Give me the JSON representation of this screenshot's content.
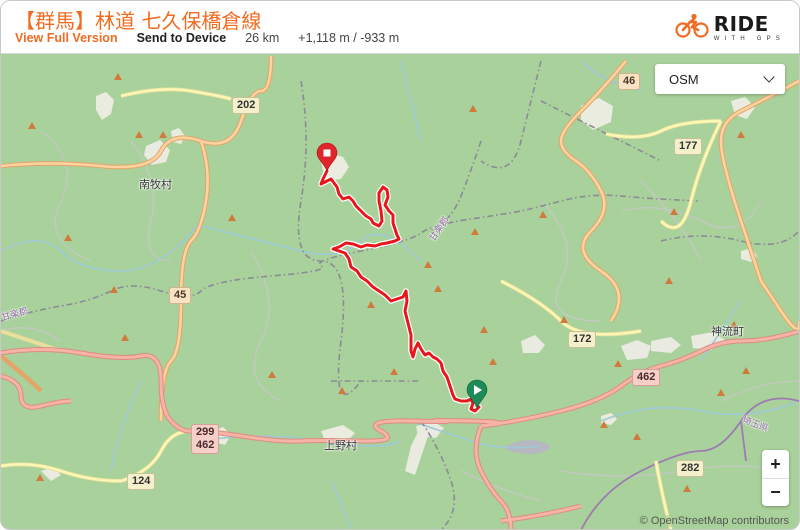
{
  "header": {
    "title": "【群馬】林道 七久保橋倉線",
    "view_full_version": "View Full Version",
    "send_to_device": "Send to Device",
    "distance": "26 km",
    "elevation": "+1,118 m / -933 m"
  },
  "logo": {
    "main": "RIDE",
    "sub": "WITH GPS",
    "accent_color": "#f26b21"
  },
  "map": {
    "layer_select": {
      "selected": "OSM"
    },
    "zoom_in_label": "+",
    "zoom_out_label": "−",
    "attribution": "© OpenStreetMap contributors",
    "route_color": "#e8151b",
    "start_marker_color": "#1e8a57",
    "end_marker_color": "#e0252c",
    "shields": [
      {
        "label": "202",
        "style": "yellow"
      },
      {
        "label": "46",
        "style": "orange"
      },
      {
        "label": "177",
        "style": "yellow"
      },
      {
        "label": "45",
        "style": "orange"
      },
      {
        "label": "172",
        "style": "yellow"
      },
      {
        "label": "462",
        "style": "red"
      },
      {
        "label": "299\n462",
        "style": "red"
      },
      {
        "label": "124",
        "style": "yellow"
      },
      {
        "label": "282",
        "style": "yellow"
      }
    ],
    "places": [
      {
        "label": "南牧村"
      },
      {
        "label": "上野村"
      },
      {
        "label": "神流町"
      },
      {
        "label": "甘楽郡"
      },
      {
        "label": "埼玉県"
      },
      {
        "label": "甘楽郡"
      }
    ]
  }
}
